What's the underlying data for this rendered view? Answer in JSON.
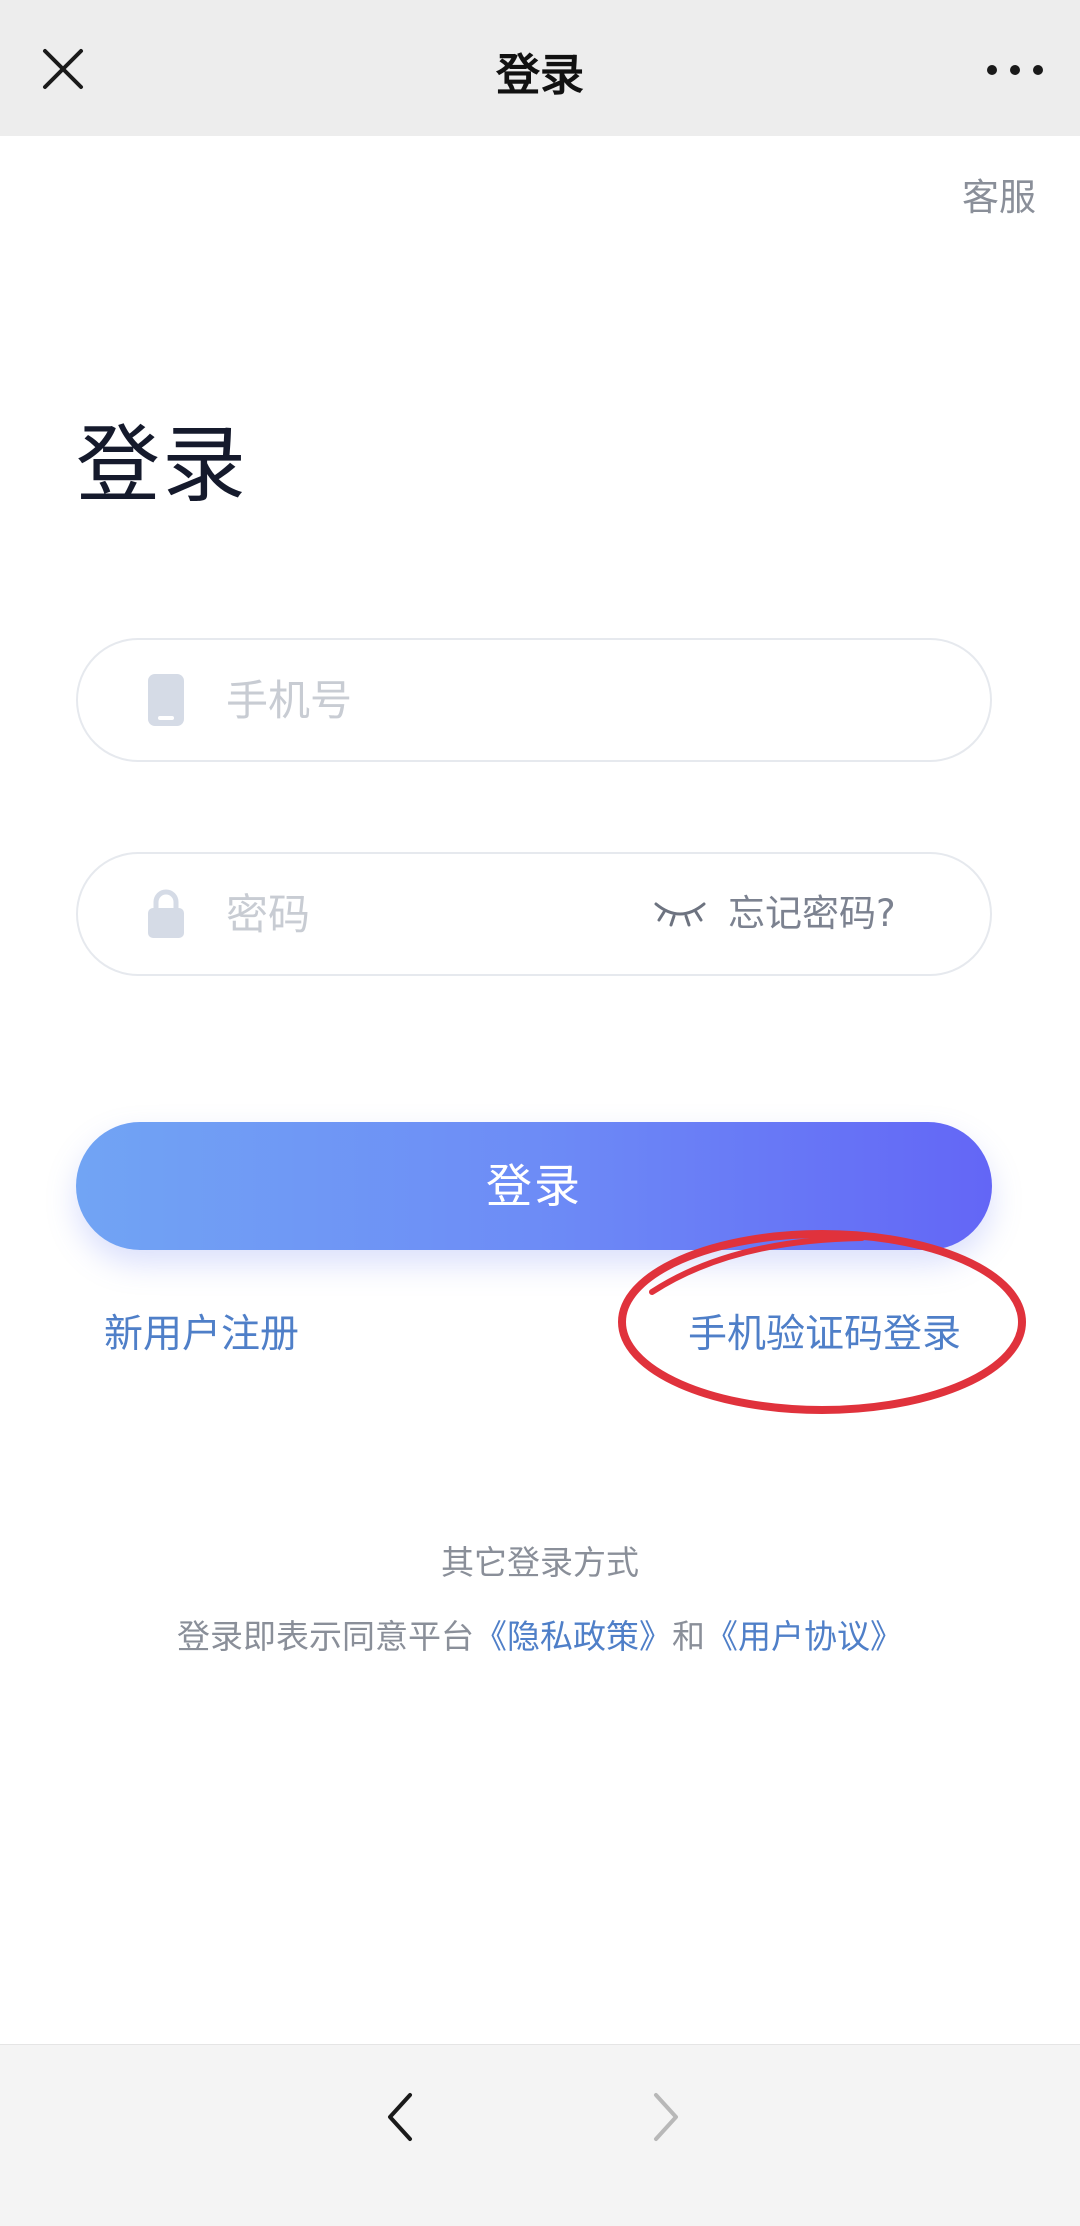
{
  "topbar": {
    "title": "登录"
  },
  "header": {
    "service_label": "客服"
  },
  "main": {
    "heading": "登录",
    "phone_field": {
      "placeholder": "手机号",
      "value": ""
    },
    "password_field": {
      "placeholder": "密码",
      "value": "",
      "forgot_label": "忘记密码?"
    },
    "login_button_label": "登录",
    "register_label": "新用户注册",
    "sms_login_label": "手机验证码登录",
    "other_login_label": "其它登录方式",
    "agreement": {
      "prefix": "登录即表示同意平台",
      "privacy_label": "《隐私政策》",
      "conjunction": "和",
      "terms_label": "《用户协议》"
    }
  },
  "icons": {
    "close": "close-icon",
    "more": "more-icon",
    "phone": "phone-icon",
    "lock": "lock-icon",
    "eye": "eye-closed-icon",
    "back": "chevron-left-icon",
    "forward": "chevron-right-icon"
  },
  "colors": {
    "link": "#4f7fc8",
    "gradient_start": "#71a4f4",
    "gradient_end": "#6366f6",
    "annotation": "#e0323c"
  }
}
